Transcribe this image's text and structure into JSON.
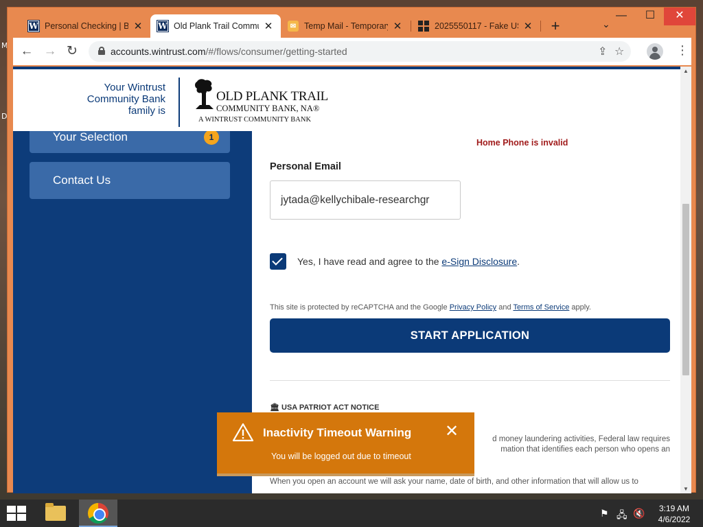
{
  "desktop": {
    "letter_top": "M",
    "letter_mid": "D"
  },
  "tabs": [
    {
      "title": "Personal Checking | Blo",
      "favicon": "W"
    },
    {
      "title": "Old Plank Trail Commun",
      "favicon": "W"
    },
    {
      "title": "Temp Mail - Temporary",
      "favicon": "mail-icon"
    },
    {
      "title": "2025550117 - Fake US",
      "favicon": "grid-icon"
    }
  ],
  "address_bar": {
    "domain": "accounts.wintrust.com",
    "path": "/#/flows/consumer/getting-started"
  },
  "header": {
    "tagline": "Your Wintrust Community Bank family is",
    "logo_line1": "OLD PLANK TRAIL",
    "logo_line2": "COMMUNITY BANK, NA®",
    "logo_line3": "A WINTRUST COMMUNITY BANK"
  },
  "sidebar": {
    "items": [
      {
        "label": "Your Selection",
        "badge": "1"
      },
      {
        "label": "Contact Us"
      }
    ]
  },
  "form": {
    "error": "Home Phone is invalid",
    "email_label": "Personal Email",
    "email_value": "jytada@kellychibale-researchgr",
    "agree_prefix": "Yes, I have read and agree to the ",
    "agree_link": "e-Sign Disclosure",
    "agree_suffix": ".",
    "agree_checked": true,
    "recaptcha_prefix": "This site is protected by reCAPTCHA and the Google ",
    "privacy_link": "Privacy Policy",
    "recaptcha_mid": " and ",
    "terms_link": "Terms of Service",
    "recaptcha_suffix": " apply.",
    "start_button": "START APPLICATION",
    "patriot_heading": "USA PATRIOT ACT NOTICE",
    "patriot_line1_visible": "d money laundering activities, Federal law requires",
    "patriot_line2_visible": "mation that identifies each person who opens an",
    "patriot_line3": "When you open an account we will ask your name, date of birth, and other information that will allow us to"
  },
  "toast": {
    "title": "Inactivity Timeout Warning",
    "message": "You will be logged out due to timeout",
    "color": "#d4770c"
  },
  "taskbar": {
    "time": "3:19 AM",
    "date": "4/6/2022"
  },
  "colors": {
    "brand_navy": "#0b3a78",
    "tab_strip": "#e8894f",
    "sidebar_item": "#3a6aa8",
    "badge": "#f5a51d"
  }
}
